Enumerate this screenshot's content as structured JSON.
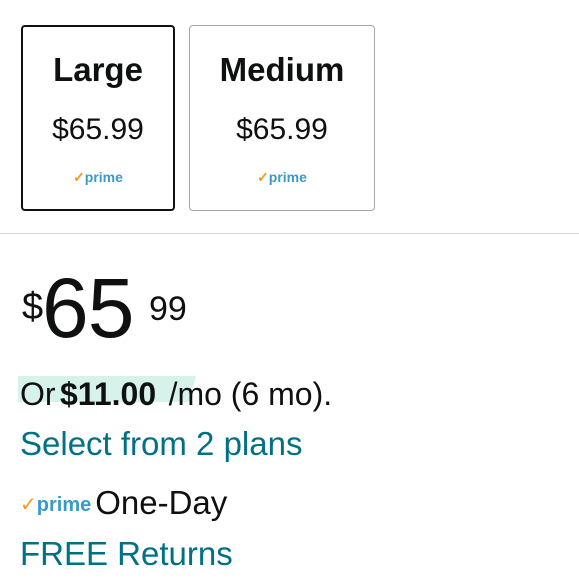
{
  "size_options": [
    {
      "name": "Large",
      "price": "$65.99",
      "prime_label": "prime",
      "selected": true
    },
    {
      "name": "Medium",
      "price": "$65.99",
      "prime_label": "prime",
      "selected": false
    }
  ],
  "price": {
    "symbol": "$",
    "whole": "65",
    "fraction": "99"
  },
  "installment": {
    "prefix": "Or",
    "amount": "$11.00",
    "terms": "/mo (6 mo)."
  },
  "plans_link": "Select from 2 plans",
  "delivery": {
    "prime_label": "prime",
    "text": "One-Day"
  },
  "returns_link": "FREE Returns",
  "colors": {
    "link": "#007185",
    "prime": "#3a9bc7",
    "prime_check": "#f39a1f",
    "highlight": "#d7f2eb"
  }
}
